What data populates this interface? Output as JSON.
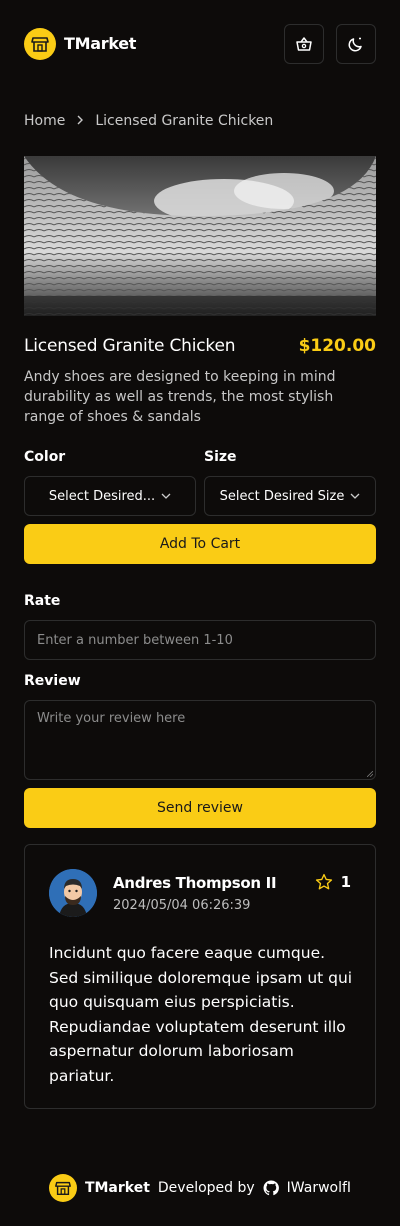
{
  "app": {
    "name": "TMarket"
  },
  "header": {
    "cart_icon": "shopping-basket-icon",
    "theme_icon": "moon-icon"
  },
  "breadcrumb": {
    "home": "Home",
    "separator": ">",
    "current": "Licensed Granite Chicken"
  },
  "product": {
    "title": "Licensed Granite Chicken",
    "price": "$120.00",
    "description": "Andy shoes are designed to keeping in mind durability as well as trends, the most stylish range of shoes & sandals",
    "color_label": "Color",
    "size_label": "Size",
    "color_select": "Select Desired...",
    "size_select": "Select Desired Size",
    "add_to_cart": "Add To Cart"
  },
  "review_form": {
    "rate_label": "Rate",
    "rate_placeholder": "Enter a number between 1-10",
    "review_label": "Review",
    "review_placeholder": "Write your review here",
    "send": "Send review"
  },
  "reviews": [
    {
      "name": "Andres Thompson II",
      "date": "2024/05/04 06:26:39",
      "rating": "1",
      "text": "Incidunt quo facere eaque cumque. Sed similique doloremque ipsam ut qui quo quisquam eius perspiciatis. Repudiandae voluptatem deserunt illo aspernatur dolorum laboriosam pariatur."
    }
  ],
  "footer": {
    "brand": "TMarket",
    "developed_by": "Developed by",
    "author": "IWarwolfI"
  },
  "colors": {
    "accent": "#facc15",
    "background": "#0d0b0a",
    "border": "#2d2d2d"
  }
}
